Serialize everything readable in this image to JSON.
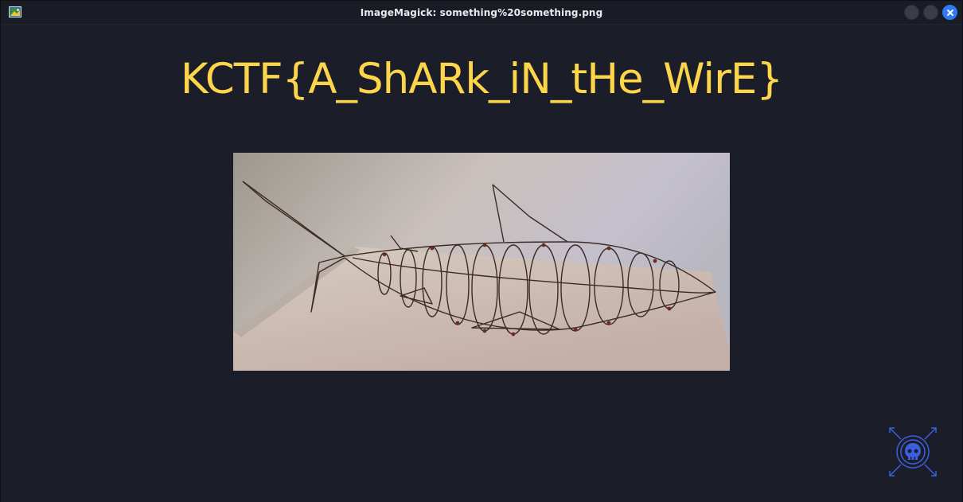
{
  "window": {
    "title": "ImageMagick: something%20something.png",
    "app_icon": "imagemagick-icon",
    "controls": [
      "minimize-icon",
      "maximize-icon",
      "close-icon"
    ]
  },
  "content": {
    "flag_text": "KCTF{A_ShARk_iN_tHe_WirE}",
    "image_subject": "wire-shark-sculpture",
    "corner_logo": "skull-logo-icon"
  },
  "colors": {
    "background": "#1b1e28",
    "titlebar": "#191c24",
    "flag_text": "#fcd54b",
    "logo": "#3b5fe0",
    "close_button": "#2f7bf2"
  }
}
